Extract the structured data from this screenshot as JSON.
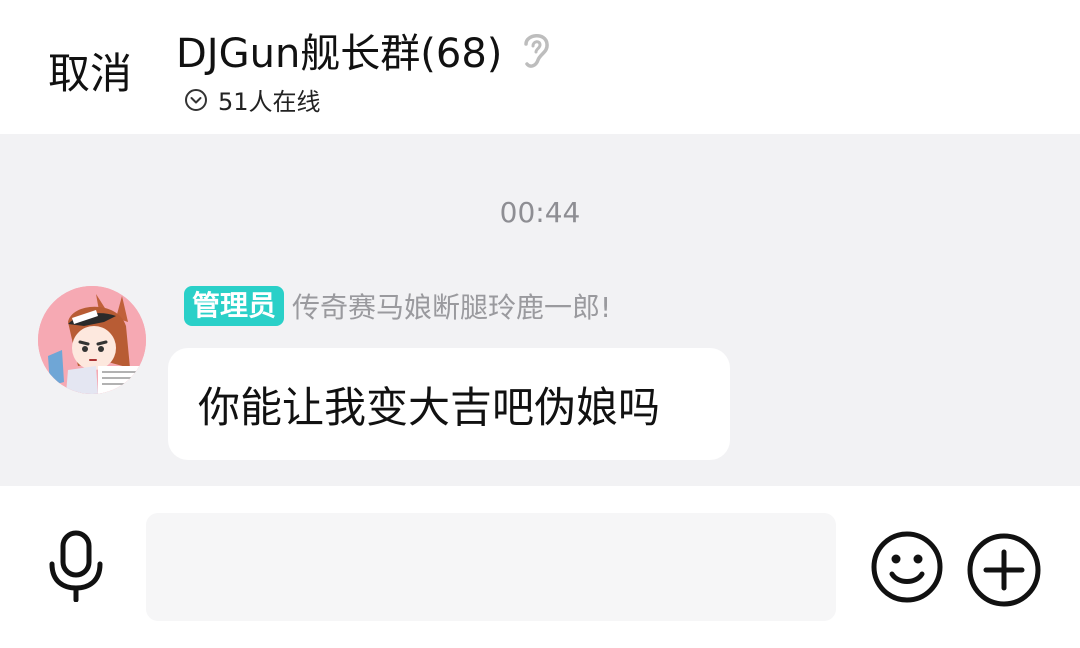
{
  "header": {
    "cancel_label": "取消",
    "title": "DJGun舰长群(68)",
    "online_text": "51人在线"
  },
  "chat": {
    "timestamp": "00:44",
    "messages": [
      {
        "badge": "管理员",
        "sender": "传奇赛马娘断腿玲鹿一郎!",
        "text": "你能让我变大吉吧伪娘吗"
      }
    ]
  },
  "input_bar": {
    "placeholder": ""
  },
  "icons": {
    "ear": "ear-icon",
    "online": "chevron-down-circle-icon",
    "mic": "microphone-icon",
    "emoji": "smiley-icon",
    "plus": "plus-circle-icon"
  },
  "colors": {
    "badge": "#2ad0c8",
    "chat_background": "#f2f2f4",
    "bubble": "#ffffff"
  }
}
